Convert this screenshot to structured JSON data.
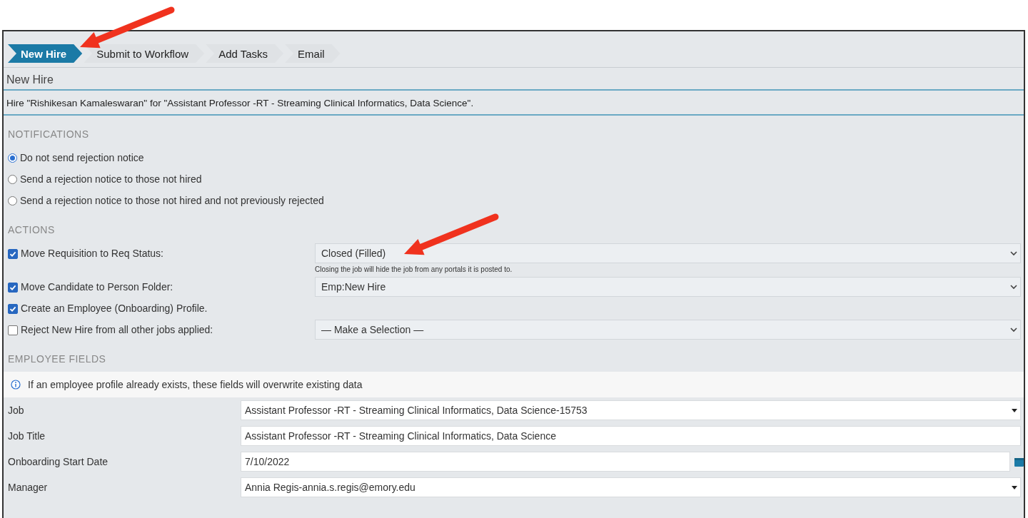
{
  "tabs": [
    {
      "label": "New Hire",
      "selected": true
    },
    {
      "label": "Submit to Workflow",
      "selected": false
    },
    {
      "label": "Add Tasks",
      "selected": false
    },
    {
      "label": "Email",
      "selected": false
    }
  ],
  "heading": "New Hire",
  "description": "Hire \"Rishikesan Kamaleswaran\" for \"Assistant Professor -RT - Streaming Clinical Informatics, Data Science\".",
  "notifications": {
    "title": "NOTIFICATIONS",
    "options": [
      {
        "label": "Do not send rejection notice",
        "selected": true
      },
      {
        "label": "Send a rejection notice to those not hired",
        "selected": false
      },
      {
        "label": "Send a rejection notice to those not hired and not previously rejected",
        "selected": false
      }
    ]
  },
  "actions": {
    "title": "ACTIONS",
    "items": [
      {
        "label": "Move Requisition to Req Status:",
        "checked": true,
        "value": "Closed (Filled)",
        "hint": "Closing the job will hide the job from any portals it is posted to."
      },
      {
        "label": "Move Candidate to Person Folder:",
        "checked": true,
        "value": "Emp:New Hire"
      },
      {
        "label": "Create an Employee (Onboarding) Profile.",
        "checked": true
      },
      {
        "label": "Reject New Hire from all other jobs applied:",
        "checked": false,
        "value": "— Make a Selection —"
      }
    ]
  },
  "employee_fields": {
    "title": "EMPLOYEE FIELDS",
    "info": "If an employee profile already exists, these fields will overwrite existing data",
    "fields": [
      {
        "label": "Job",
        "kind": "select",
        "value": "Assistant Professor -RT - Streaming Clinical Informatics, Data Science-15753"
      },
      {
        "label": "Job Title",
        "kind": "text",
        "value": "Assistant Professor -RT - Streaming Clinical Informatics, Data Science"
      },
      {
        "label": "Onboarding Start Date",
        "kind": "date",
        "value": "7/10/2022"
      },
      {
        "label": "Manager",
        "kind": "select",
        "value": "Annia Regis-annia.s.regis@emory.edu"
      }
    ]
  }
}
